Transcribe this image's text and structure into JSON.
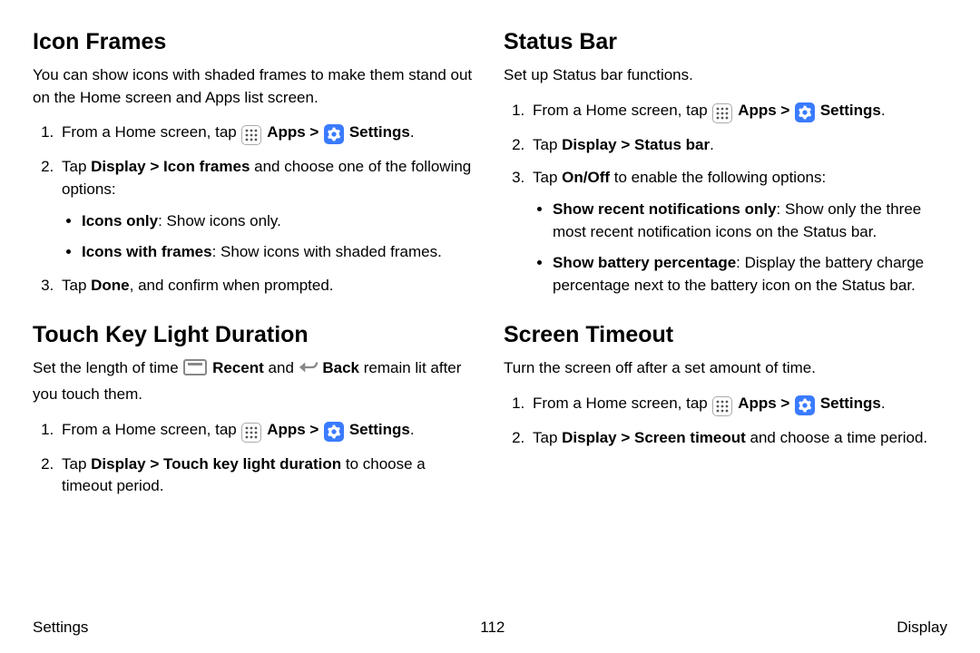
{
  "left": {
    "s1": {
      "title": "Icon Frames",
      "intro": "You can show icons with shaded frames to make them stand out on the Home screen and Apps list screen.",
      "step1a": "From a Home screen, tap ",
      "apps": "Apps",
      "gt": " > ",
      "settings": "Settings",
      "period": ".",
      "step2a": "Tap ",
      "step2b": "Display > Icon frames",
      "step2c": " and choose one of the following options:",
      "bullet1a": "Icons only",
      "bullet1b": ": Show icons only.",
      "bullet2a": "Icons with frames",
      "bullet2b": ": Show icons with shaded frames.",
      "step3a": "Tap ",
      "step3b": "Done",
      "step3c": ", and confirm when prompted."
    },
    "s2": {
      "title": "Touch Key Light Duration",
      "intro1": "Set the length of time ",
      "recent": "Recent",
      "intro2": " and ",
      "back": "Back",
      "intro3": " remain lit after you touch them.",
      "step1a": "From a Home screen, tap ",
      "apps": "Apps",
      "gt": " > ",
      "settings": "Settings",
      "period": ".",
      "step2a": "Tap ",
      "step2b": "Display > Touch key light duration",
      "step2c": " to choose a timeout period."
    }
  },
  "right": {
    "s1": {
      "title": "Status Bar",
      "intro": "Set up Status bar functions.",
      "step1a": "From a Home screen, tap ",
      "apps": "Apps",
      "gt": " > ",
      "settings": "Settings",
      "period": ".",
      "step2a": "Tap ",
      "step2b": "Display > Status bar",
      "step2c": ".",
      "step3a": "Tap ",
      "step3b": "On/Off",
      "step3c": " to enable the following options:",
      "bullet1a": "Show recent notifications only",
      "bullet1b": ": Show only the three most recent notification icons on the Status bar.",
      "bullet2a": "Show battery percentage",
      "bullet2b": ": Display the battery charge percentage next to the battery icon on the Status bar."
    },
    "s2": {
      "title": "Screen Timeout",
      "intro": "Turn the screen off after a set amount of time.",
      "step1a": "From a Home screen, tap ",
      "apps": "Apps",
      "gt": " > ",
      "settings": "Settings",
      "period": ".",
      "step2a": "Tap ",
      "step2b": "Display > Screen timeout",
      "step2c": " and choose a time period."
    }
  },
  "footer": {
    "left": "Settings",
    "center": "112",
    "right": "Display"
  }
}
